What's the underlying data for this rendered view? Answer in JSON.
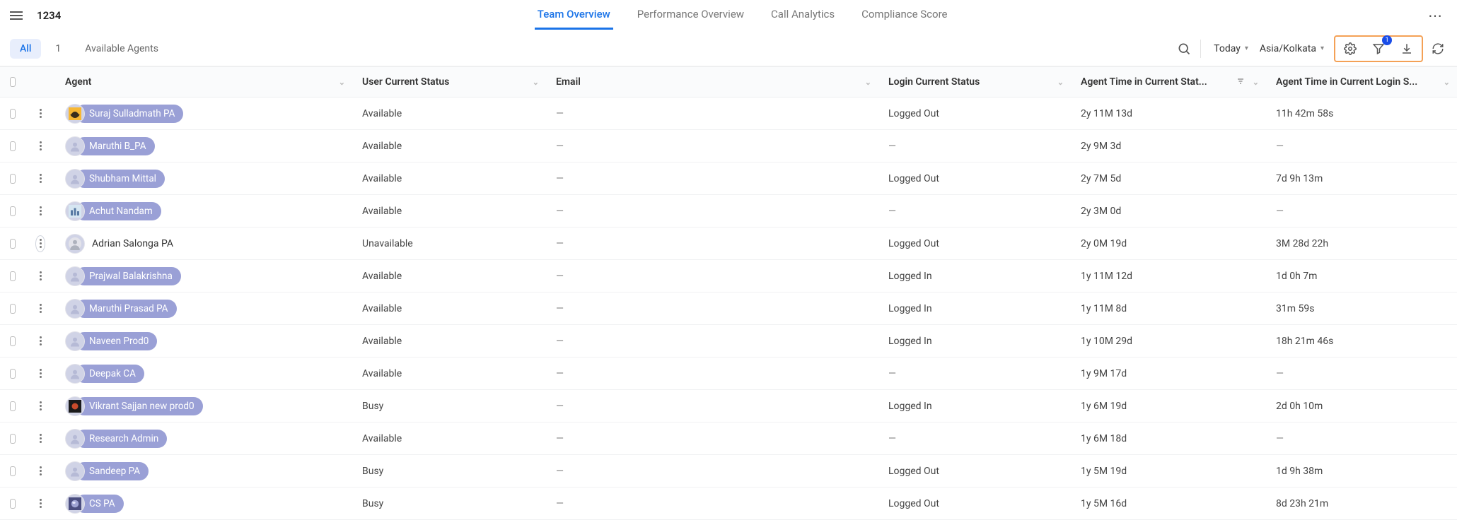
{
  "header": {
    "title": "1234",
    "tabs": [
      {
        "label": "Team Overview",
        "active": true
      },
      {
        "label": "Performance Overview"
      },
      {
        "label": "Call Analytics"
      },
      {
        "label": "Compliance Score"
      }
    ]
  },
  "toolbar": {
    "filters": [
      {
        "label": "All",
        "active": true
      },
      {
        "label": "1"
      },
      {
        "label": "Available Agents"
      }
    ],
    "range": "Today",
    "timezone": "Asia/Kolkata",
    "filter_badge": "1"
  },
  "columns": {
    "agent": "Agent",
    "user_status": "User Current Status",
    "email": "Email",
    "login_status": "Login Current Status",
    "time_status": "Agent Time in Current Stat...",
    "time_login": "Agent Time in Current Login S..."
  },
  "rows": [
    {
      "name": "Suraj Sulladmath PA",
      "chip": true,
      "avatar": "bat",
      "status": "Available",
      "email": "—",
      "login": "Logged Out",
      "t1": "2y 11M 13d",
      "t2": "11h 42m 58s"
    },
    {
      "name": "Maruthi B_PA",
      "chip": true,
      "avatar": "placeholder",
      "status": "Available",
      "email": "—",
      "login": "—",
      "t1": "2y 9M 3d",
      "t2": "—"
    },
    {
      "name": "Shubham Mittal",
      "chip": true,
      "avatar": "placeholder",
      "status": "Available",
      "email": "—",
      "login": "Logged Out",
      "t1": "2y 7M 5d",
      "t2": "7d 9h 13m"
    },
    {
      "name": "Achut Nandam",
      "chip": true,
      "avatar": "city",
      "status": "Available",
      "email": "—",
      "login": "—",
      "t1": "2y 3M 0d",
      "t2": "—"
    },
    {
      "name": "Adrian Salonga PA",
      "chip": false,
      "avatar": "person",
      "status": "Unavailable",
      "email": "—",
      "login": "Logged Out",
      "t1": "2y 0M 19d",
      "t2": "3M 28d 22h",
      "rowActive": true
    },
    {
      "name": "Prajwal Balakrishna",
      "chip": true,
      "avatar": "placeholder",
      "status": "Available",
      "email": "—",
      "login": "Logged In",
      "t1": "1y 11M 12d",
      "t2": "1d 0h 7m"
    },
    {
      "name": "Maruthi Prasad PA",
      "chip": true,
      "avatar": "placeholder",
      "status": "Available",
      "email": "—",
      "login": "Logged In",
      "t1": "1y 11M 8d",
      "t2": "31m 59s"
    },
    {
      "name": "Naveen Prod0",
      "chip": true,
      "avatar": "placeholder",
      "status": "Available",
      "email": "—",
      "login": "Logged In",
      "t1": "1y 10M 29d",
      "t2": "18h 21m 46s"
    },
    {
      "name": "Deepak CA",
      "chip": true,
      "avatar": "placeholder",
      "status": "Available",
      "email": "—",
      "login": "—",
      "t1": "1y 9M 17d",
      "t2": "—"
    },
    {
      "name": "Vikrant Sajjan new prod0",
      "chip": true,
      "avatar": "dark",
      "status": "Busy",
      "email": "—",
      "login": "Logged In",
      "t1": "1y 6M 19d",
      "t2": "2d 0h 10m"
    },
    {
      "name": "Research Admin",
      "chip": true,
      "avatar": "placeholder",
      "status": "Available",
      "email": "—",
      "login": "—",
      "t1": "1y 6M 18d",
      "t2": "—"
    },
    {
      "name": "Sandeep PA",
      "chip": true,
      "avatar": "placeholder",
      "status": "Busy",
      "email": "—",
      "login": "Logged Out",
      "t1": "1y 5M 19d",
      "t2": "1d 9h 38m"
    },
    {
      "name": "CS PA",
      "chip": true,
      "avatar": "sphere",
      "status": "Busy",
      "email": "—",
      "login": "Logged Out",
      "t1": "1y 5M 16d",
      "t2": "8d 23h 21m"
    }
  ]
}
